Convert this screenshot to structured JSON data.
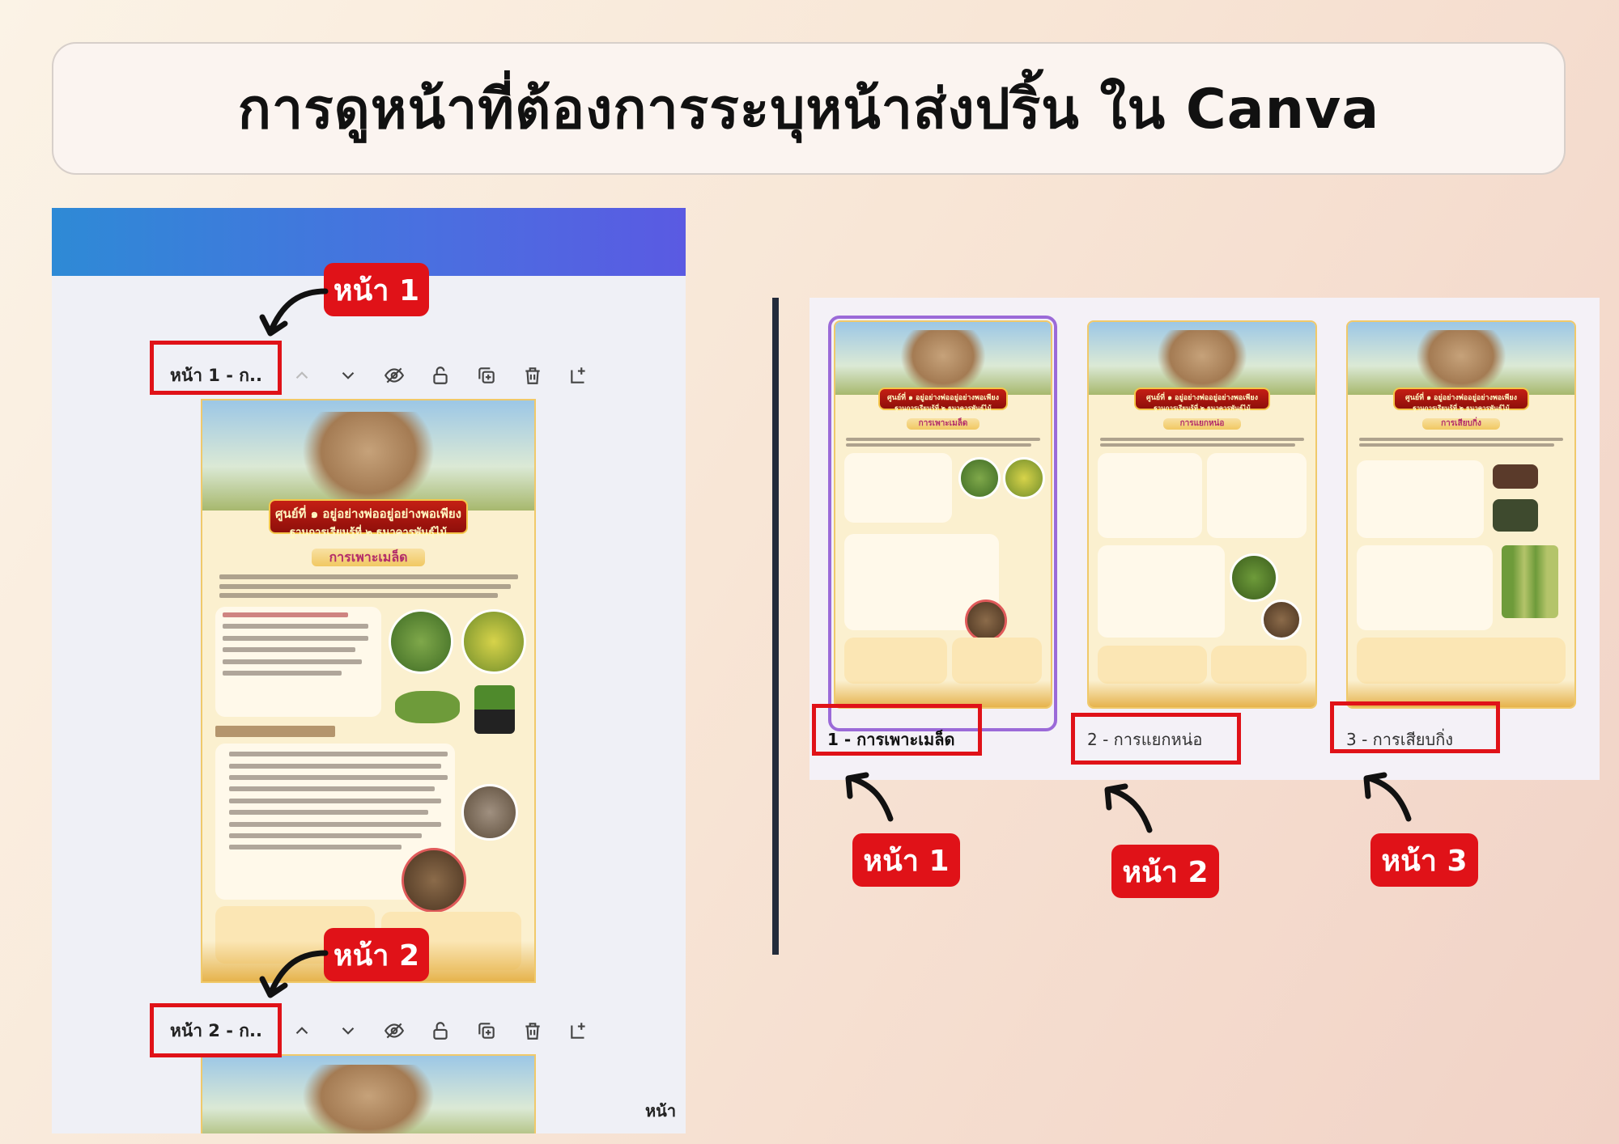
{
  "title": "การดูหน้าที่ต้องการระบุหน้าส่งปริ้น ใน Canva",
  "editor": {
    "toolbar1_label": "หน้า 1 - ก..",
    "toolbar2_label": "หน้า 2 - ก..",
    "bottom_hint": "หน้า",
    "toolbar_icons": [
      "chevron-up-icon",
      "chevron-down-icon",
      "eye-hide-icon",
      "lock-icon",
      "duplicate-icon",
      "trash-icon",
      "add-page-icon"
    ]
  },
  "callouts": {
    "left_page1": "หน้า 1",
    "left_page2": "หน้า 2",
    "right_page1": "หน้า 1",
    "right_page2": "หน้า 2",
    "right_page3": "หน้า 3"
  },
  "poster": {
    "banner_line1": "ศูนย์ที่ ๑ อยู่อย่างพ่ออยู่อย่างพอเพียง",
    "banner_line2": "ฐานการเรียนรู้ที่ ๒ ธนาคารพันธุ์ไม้"
  },
  "thumbnails": [
    {
      "label": "1 - การเพาะเมล็ด",
      "section": "การเพาะเมล็ด",
      "selected": true
    },
    {
      "label": "2 - การแยกหน่อ",
      "section": "การแยกหน่อ",
      "selected": false
    },
    {
      "label": "3 - การเสียบกิ่ง",
      "section": "การเสียบกิ่ง",
      "selected": false
    }
  ],
  "colors": {
    "callout_red": "#e01218",
    "selection_purple": "#9b6ad8",
    "topbar_blue": "#4a6fe0"
  }
}
